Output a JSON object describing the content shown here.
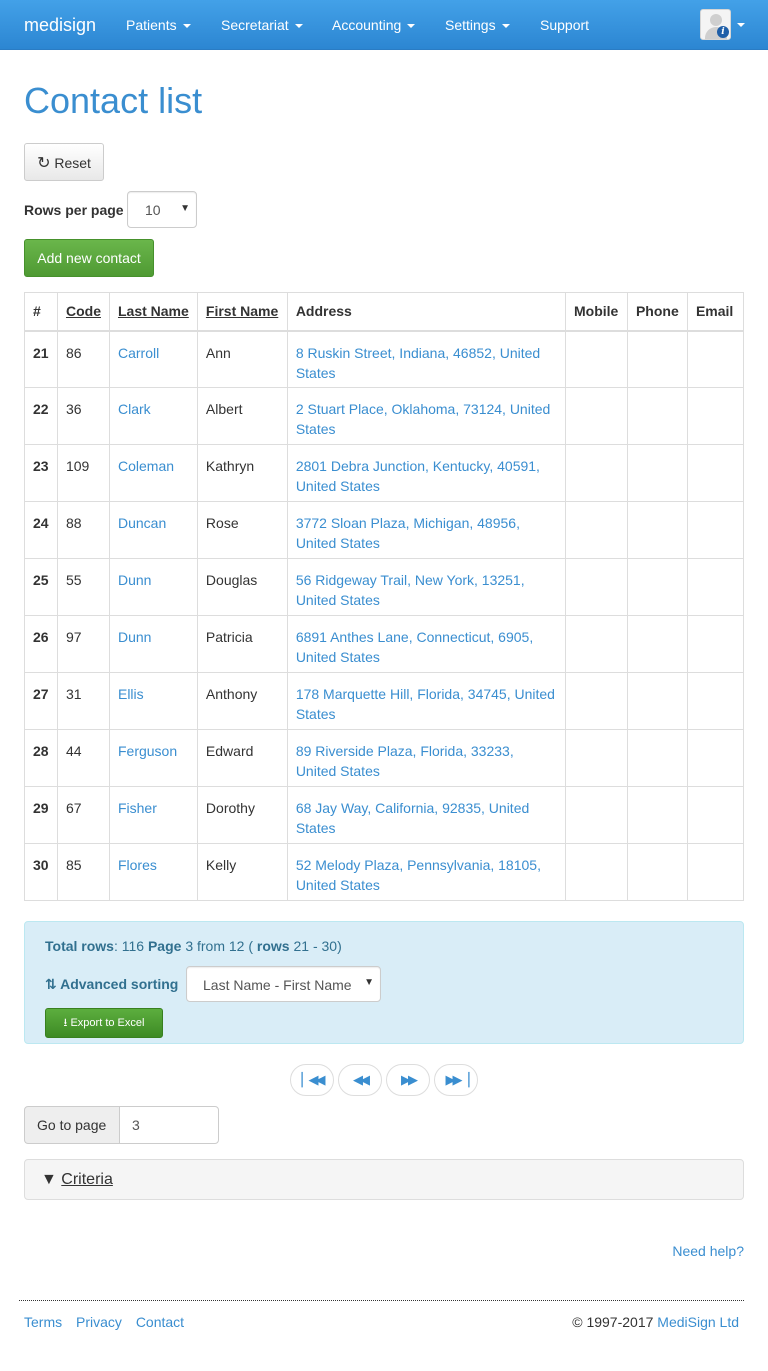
{
  "navbar": {
    "brand": "medisign",
    "items": [
      "Patients",
      "Secretariat",
      "Accounting",
      "Settings",
      "Support"
    ],
    "brand_color": "#2f8fdc"
  },
  "page": {
    "title": "Contact list",
    "reset_label": "Reset",
    "rows_per_page_label": "Rows per page",
    "rows_per_page_value": "10",
    "add_label": "Add new contact"
  },
  "table": {
    "headers": [
      "#",
      "Code",
      "Last Name",
      "First Name",
      "Address",
      "Mobile",
      "Phone",
      "Email"
    ],
    "rows": [
      {
        "num": "21",
        "code": "86",
        "last": "Carroll",
        "first": "Ann",
        "address": "8 Ruskin Street, Indiana, 46852, United States"
      },
      {
        "num": "22",
        "code": "36",
        "last": "Clark",
        "first": "Albert",
        "address": "2 Stuart Place, Oklahoma, 73124, United States"
      },
      {
        "num": "23",
        "code": "109",
        "last": "Coleman",
        "first": "Kathryn",
        "address": "2801 Debra Junction, Kentucky, 40591, United States"
      },
      {
        "num": "24",
        "code": "88",
        "last": "Duncan",
        "first": "Rose",
        "address": "3772 Sloan Plaza, Michigan, 48956, United States"
      },
      {
        "num": "25",
        "code": "55",
        "last": "Dunn",
        "first": "Douglas",
        "address": "56 Ridgeway Trail, New York, 13251, United States"
      },
      {
        "num": "26",
        "code": "97",
        "last": "Dunn",
        "first": "Patricia",
        "address": "6891 Anthes Lane, Connecticut, 6905, United States"
      },
      {
        "num": "27",
        "code": "31",
        "last": "Ellis",
        "first": "Anthony",
        "address": "178 Marquette Hill, Florida, 34745, United States"
      },
      {
        "num": "28",
        "code": "44",
        "last": "Ferguson",
        "first": "Edward",
        "address": "89 Riverside Plaza, Florida, 33233, United States"
      },
      {
        "num": "29",
        "code": "67",
        "last": "Fisher",
        "first": "Dorothy",
        "address": "68 Jay Way, California, 92835, United States"
      },
      {
        "num": "30",
        "code": "85",
        "last": "Flores",
        "first": "Kelly",
        "address": "52 Melody Plaza, Pennsylvania, 18105, United States"
      }
    ]
  },
  "summary": {
    "total_rows_label": "Total rows",
    "total_rows_value": ": 116",
    "page_label": "Page",
    "page_text": "3 from 12 (",
    "rows_label": "rows",
    "rows_range": "21 - 30)",
    "advanced_sorting_label": "Advanced sorting",
    "sort_value": "Last Name - First Name",
    "export_label": "Export to Excel"
  },
  "pager": {
    "first_icon": "fast-backward-icon",
    "prev_icon": "backward-icon",
    "next_icon": "forward-icon",
    "last_icon": "fast-forward-icon"
  },
  "goto": {
    "label": "Go to page",
    "value": "3"
  },
  "criteria": {
    "label": "Criteria"
  },
  "footer": {
    "help": "Need help?",
    "links": [
      "Terms",
      "Privacy",
      "Contact"
    ],
    "copyright_prefix": "© 1997-2017",
    "company": "MediSign Ltd"
  }
}
